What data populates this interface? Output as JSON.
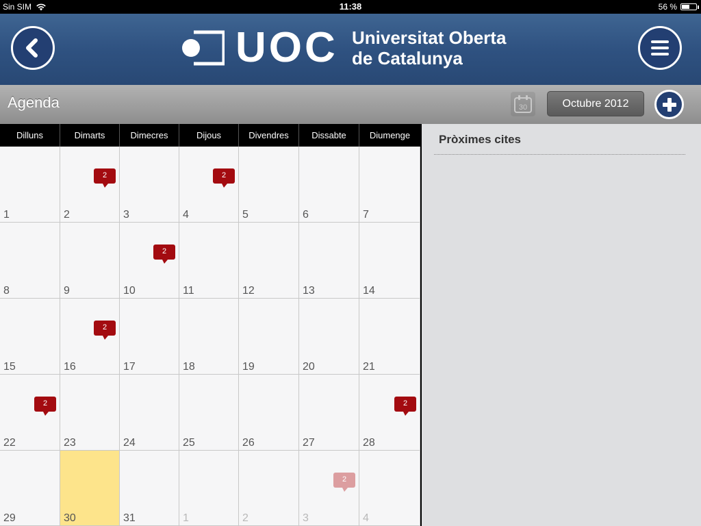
{
  "status_bar": {
    "carrier": "Sin SIM",
    "time": "11:38",
    "battery": "56 %",
    "battery_level": 0.56
  },
  "header": {
    "logo_text": "UOC",
    "university_line1": "Universitat Oberta",
    "university_line2": "de Catalunya",
    "back_icon": "chevron-left-icon",
    "menu_icon": "hamburger-menu-icon",
    "accent_color": "#2f5281"
  },
  "toolbar": {
    "title": "Agenda",
    "today_icon_label": "30",
    "month_label": "Octubre 2012",
    "add_icon": "plus-icon"
  },
  "calendar": {
    "weekdays": [
      "Dilluns",
      "Dimarts",
      "Dimecres",
      "Dijous",
      "Divendres",
      "Dissabte",
      "Diumenge"
    ],
    "weeks": [
      [
        {
          "day": "1"
        },
        {
          "day": "2",
          "badge": "2"
        },
        {
          "day": "3"
        },
        {
          "day": "4",
          "badge": "2"
        },
        {
          "day": "5"
        },
        {
          "day": "6"
        },
        {
          "day": "7"
        }
      ],
      [
        {
          "day": "8"
        },
        {
          "day": "9"
        },
        {
          "day": "10",
          "badge": "2"
        },
        {
          "day": "11"
        },
        {
          "day": "12"
        },
        {
          "day": "13"
        },
        {
          "day": "14"
        }
      ],
      [
        {
          "day": "15"
        },
        {
          "day": "16",
          "badge": "2"
        },
        {
          "day": "17"
        },
        {
          "day": "18"
        },
        {
          "day": "19"
        },
        {
          "day": "20"
        },
        {
          "day": "21"
        }
      ],
      [
        {
          "day": "22",
          "badge": "2"
        },
        {
          "day": "23"
        },
        {
          "day": "24"
        },
        {
          "day": "25"
        },
        {
          "day": "26"
        },
        {
          "day": "27"
        },
        {
          "day": "28",
          "badge": "2"
        }
      ],
      [
        {
          "day": "29"
        },
        {
          "day": "30",
          "today": true
        },
        {
          "day": "31"
        },
        {
          "day": "1",
          "other": true
        },
        {
          "day": "2",
          "other": true
        },
        {
          "day": "3",
          "other": true,
          "badge": "2"
        },
        {
          "day": "4",
          "other": true
        }
      ]
    ],
    "badge_color": "#a30b10",
    "today_color": "#fde48b"
  },
  "side_panel": {
    "title": "Pròximes cites"
  }
}
